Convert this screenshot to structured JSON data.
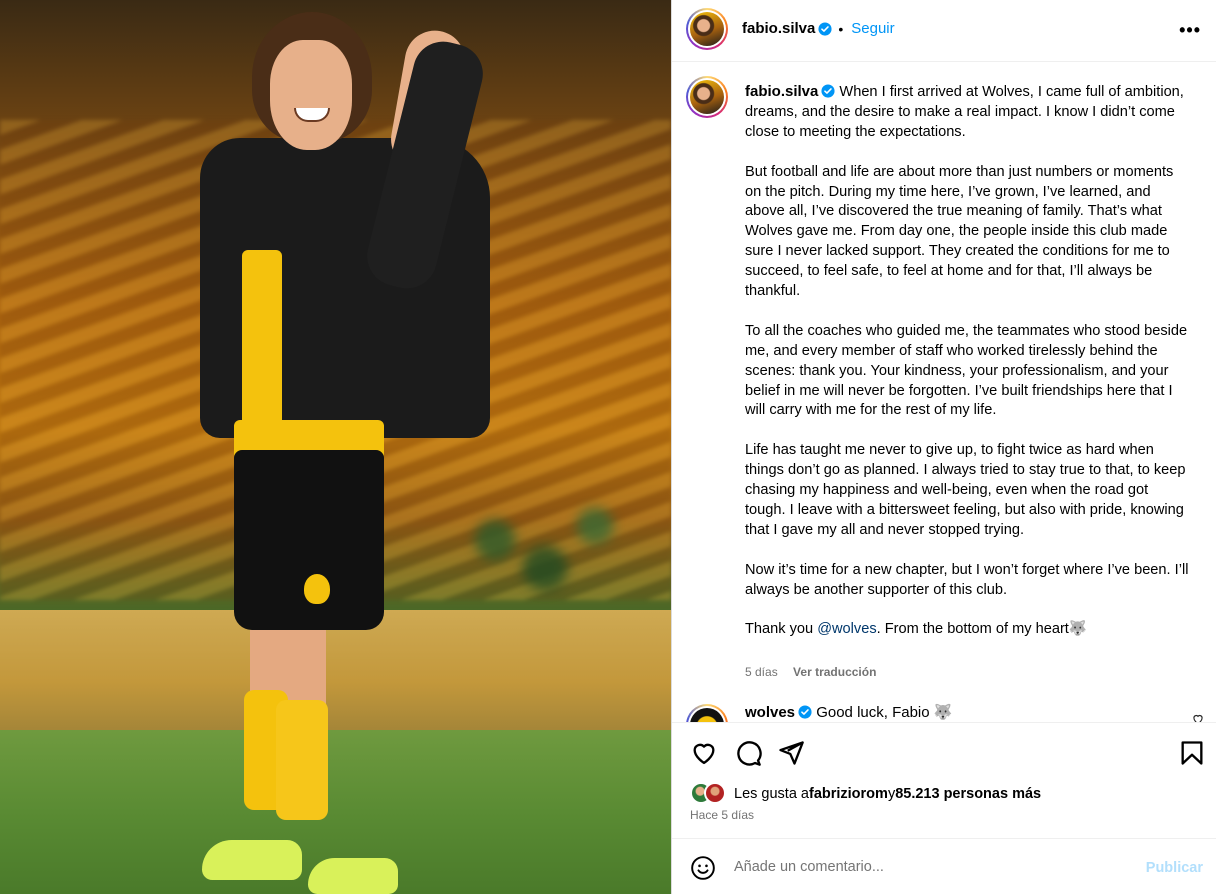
{
  "post": {
    "username": "fabio.silva",
    "follow_label": "Seguir",
    "more_label": "•••",
    "caption_paragraphs": [
      "When I first arrived at Wolves, I came full of ambition, dreams, and the desire to make a real impact. I know I didn’t come close to meeting the expectations.",
      "But football and life are about more than just numbers or moments on the pitch. During my time here, I’ve grown, I’ve learned, and above all, I’ve discovered the true meaning of family. That’s what Wolves gave me. From day one, the people inside this club made sure I never lacked support. They created the conditions for me to succeed, to feel safe, to feel at home and for that, I’ll always be thankful.",
      "To all the coaches who guided me, the teammates who stood beside me, and every member of staff who worked tirelessly behind the scenes: thank you. Your kindness, your professionalism, and your belief in me will never be forgotten. I’ve built friendships here that I will carry with me for the rest of my life.",
      "Life has taught me never to give up, to fight twice as hard when things don’t go as planned. I always tried to stay true to that, to keep chasing my happiness and well-being, even when the road got tough. I leave with a bittersweet feeling, but also with pride, knowing that I gave my all and never stopped trying.",
      "Now it’s time for a new chapter, but I won’t forget where I’ve been. I’ll always be another supporter of this club."
    ],
    "closing_prefix": "Thank you ",
    "closing_mention": "@wolves",
    "closing_suffix": ". From the bottom of my heart🐺",
    "time_short": "5 días",
    "translate_label": "Ver traducción",
    "accent_color": "#0095f6"
  },
  "comment": {
    "username": "wolves",
    "text": "Good luck, Fabio 🐺"
  },
  "likes": {
    "prefix": "Les gusta a ",
    "first_user": "fabriziorom",
    "middle": " y ",
    "others": "85.213 personas más"
  },
  "timestamp": "Hace 5 días",
  "add_comment": {
    "placeholder": "Añade un comentario...",
    "publish_label": "Publicar"
  },
  "icons": [
    "heart-icon",
    "comment-icon",
    "share-icon",
    "bookmark-icon",
    "emoji-icon",
    "verified-icon",
    "more-icon"
  ]
}
